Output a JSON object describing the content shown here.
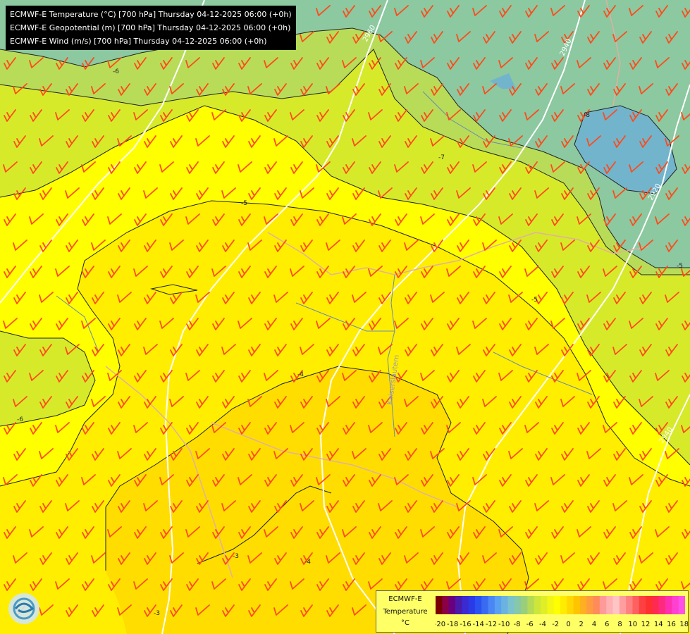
{
  "header": {
    "lines": [
      "ECMWF-E Temperature (°C) [700 hPa] Thursday 04-12-2025 06:00 (+0h)",
      "ECMWF-E Geopotential (m) [700 hPa] Thursday 04-12-2025 06:00 (+0h)",
      "ECMWF-E Wind (m/s) [700 hPa] Thursday 04-12-2025 06:00 (+0h)"
    ]
  },
  "legend": {
    "model": "ECMWF-E",
    "variable": "Temperature",
    "unit": "°C",
    "ticks": [
      "-20",
      "-18",
      "-16",
      "-14",
      "-12",
      "-10",
      "-8",
      "-6",
      "-4",
      "-2",
      "0",
      "2",
      "4",
      "6",
      "8",
      "10",
      "12",
      "14",
      "16",
      "18"
    ],
    "colors": [
      "#7a0000",
      "#8a0044",
      "#6a0080",
      "#4a1aa8",
      "#3a2ad0",
      "#2a3ae6",
      "#2a52f0",
      "#3a6af2",
      "#4a86f4",
      "#5aa0f0",
      "#6ab2e0",
      "#7ac2cc",
      "#86c8a8",
      "#9ace7a",
      "#b4da56",
      "#cce63a",
      "#e0ee28",
      "#f4f614",
      "#ffff00",
      "#ffec00",
      "#ffd800",
      "#ffc400",
      "#ffb020",
      "#ff9c40",
      "#ff8a5a",
      "#ff9a9a",
      "#ffb0b0",
      "#ffc4c4",
      "#ff9e9e",
      "#ff8080",
      "#ff6060",
      "#ff4040",
      "#ff3030",
      "#ff2a50",
      "#ff2a80",
      "#ff30b0",
      "#ff40d0",
      "#ff50e8"
    ]
  },
  "contour_labels": {
    "isotherms": [
      "-8",
      "-7",
      "-6",
      "-5",
      "-5",
      "-4",
      "-4",
      "-3",
      "-3",
      "-5",
      "-6"
    ],
    "geopotential": [
      "2960",
      "2940",
      "2920",
      "2940"
    ]
  },
  "place_label": "Kaiserslautern",
  "map_colors": {
    "t_le_-8": "#72b4cc",
    "t_-8_-7": "#8cc8a0",
    "t_-7_-6": "#b8dc58",
    "t_-6_-5": "#d6ea2a",
    "t_-5_-4": "#ffff00",
    "t_-4_-3": "#ffee00",
    "t_-3_-2": "#ffdd00",
    "wind_barb": "#ff4a1a",
    "geopotential_line": "#ffffff",
    "isotherm_line": "#222222",
    "border": "#e0b0a0",
    "river": "#6a8ab0"
  }
}
